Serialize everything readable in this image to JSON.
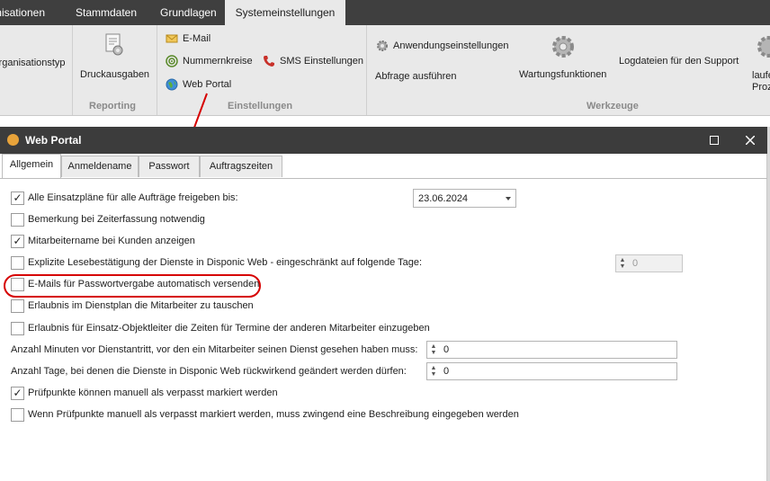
{
  "ribbon": {
    "tabs": [
      "Organisationen",
      "Stammdaten",
      "Grundlagen",
      "Systemeinstellungen"
    ],
    "items": {
      "organisationstyp": "Organisationstyp",
      "druckausgaben": "Druckausgaben",
      "email": "E-Mail",
      "nummernkreise": "Nummernkreise",
      "web_portal": "Web Portal",
      "sms": "SMS Einstellungen",
      "anwendungseinstellungen": "Anwendungseinstellungen",
      "abfrage": "Abfrage ausführen",
      "wartungsfunktionen": "Wartungsfunktionen",
      "logdateien": "Logdateien für den Support",
      "laufende_1": "laufe",
      "laufende_2": "Proz"
    },
    "groups": [
      "Reporting",
      "Einstellungen",
      "Werkzeuge"
    ]
  },
  "dialog": {
    "title": "Web Portal",
    "tabs": [
      "Allgemein",
      "Anmeldename",
      "Passwort",
      "Auftragszeiten"
    ],
    "options": [
      {
        "label": "Alle Einsatzpläne für alle Aufträge freigeben bis:",
        "checked": true
      },
      {
        "label": "Bemerkung bei Zeiterfassung notwendig",
        "checked": false
      },
      {
        "label": "Mitarbeitername bei Kunden anzeigen",
        "checked": true
      },
      {
        "label": "Explizite Lesebestätigung der Dienste in Disponic Web - eingeschränkt auf folgende Tage:",
        "checked": false
      },
      {
        "label": "E-Mails für Passwortvergabe automatisch versenden",
        "checked": false
      },
      {
        "label": "Erlaubnis im Dienstplan die Mitarbeiter zu tauschen",
        "checked": false
      },
      {
        "label": "Erlaubnis für  Einsatz-Objektleiter die Zeiten für Termine der anderen Mitarbeiter einzugeben",
        "checked": false
      }
    ],
    "date_value": "23.06.2024",
    "lesebestaetigung_days": "0",
    "minuten_label": "Anzahl Minuten vor Dienstantritt,  vor den ein Mitarbeiter seinen Dienst gesehen haben muss:",
    "minuten_value": "0",
    "tage_label": "Anzahl Tage, bei denen die Dienste in Disponic Web rückwirkend geändert werden dürfen:",
    "tage_value": "0",
    "options2": [
      {
        "label": "Prüfpunkte können manuell als verpasst markiert werden",
        "checked": true
      },
      {
        "label": "Wenn Prüfpunkte manuell als verpasst markiert werden, muss zwingend eine Beschreibung eingegeben werden",
        "checked": false
      }
    ],
    "check_glyph": "✓"
  }
}
